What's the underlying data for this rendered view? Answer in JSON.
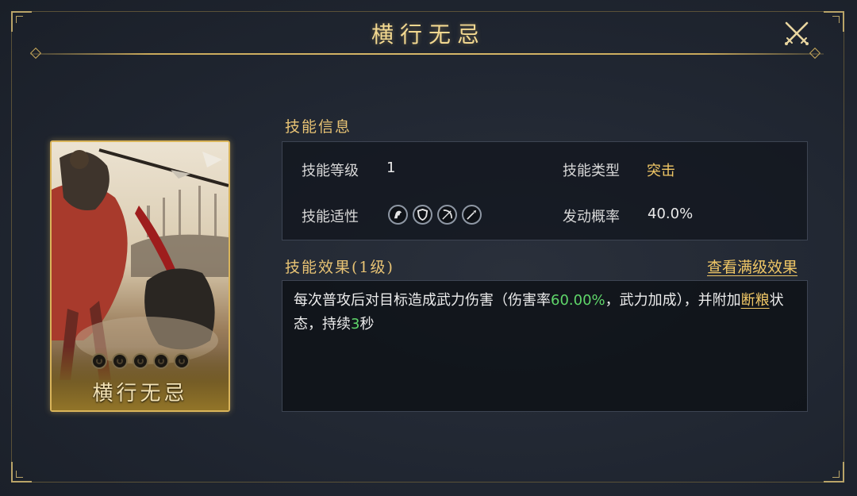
{
  "title": "横行无忌",
  "card": {
    "name": "横行无忌",
    "star_count": 5
  },
  "skill_info": {
    "heading": "技能信息",
    "level_label": "技能等级",
    "level_value": "1",
    "type_label": "技能类型",
    "type_value": "突击",
    "aptitude_label": "技能适性",
    "aptitude_icons": [
      "cavalry-icon",
      "shield-icon",
      "bow-icon",
      "spear-icon"
    ],
    "trigger_label": "发动概率",
    "trigger_value": "40.0%"
  },
  "effect": {
    "heading": "技能效果(1级)",
    "view_max_label": "查看满级效果",
    "text_part1": "每次普攻后对目标造成武力伤害（伤害率",
    "damage_rate": "60.00%",
    "text_part2": "，武力加成），并附加",
    "status_name": "断粮",
    "text_part3": "状态，持续",
    "duration": "3",
    "text_part4": "秒"
  },
  "colors": {
    "gold": "#f0c766",
    "green": "#5fd66a",
    "title": "#f2d890"
  }
}
